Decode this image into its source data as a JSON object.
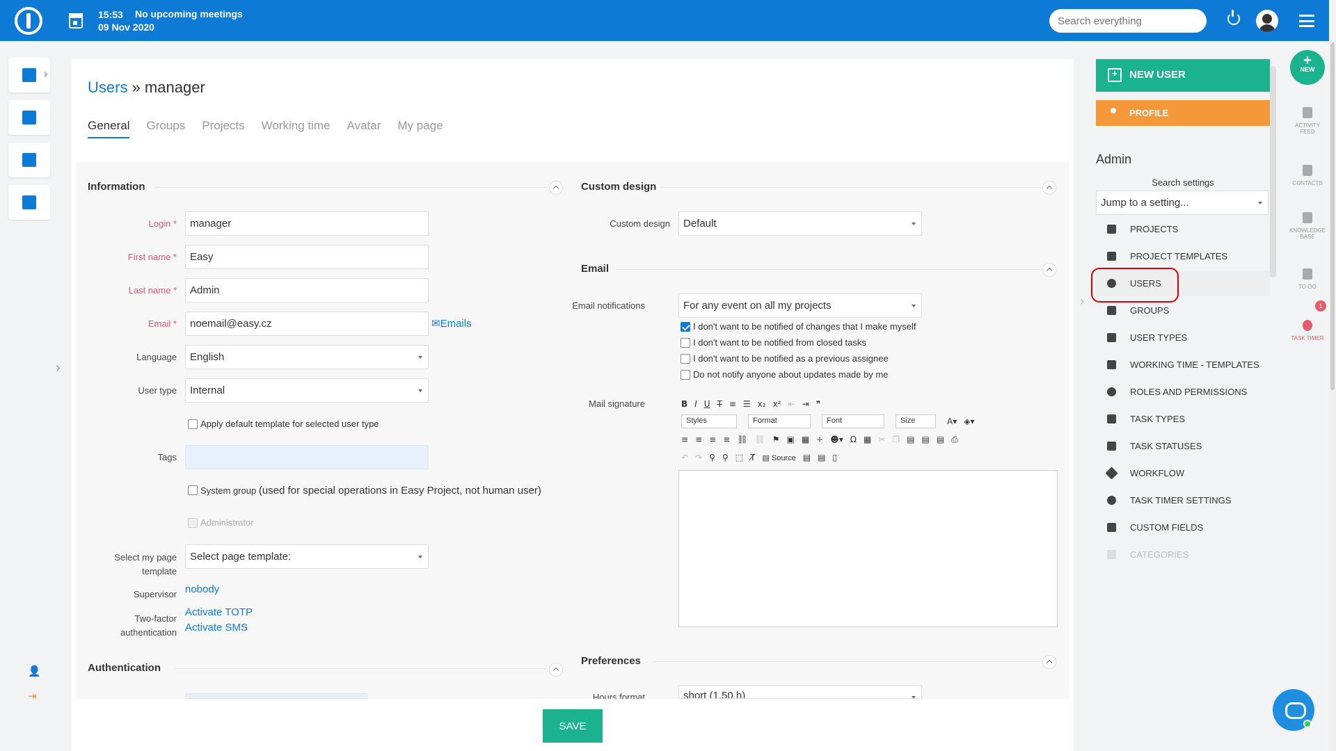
{
  "topbar": {
    "time": "15:53",
    "date": "09 Nov 2020",
    "meetings": "No upcoming meetings",
    "search_placeholder": "Search everything"
  },
  "breadcrumb": {
    "root": "Users",
    "separator": " » ",
    "current": "manager"
  },
  "tabs": [
    "General",
    "Groups",
    "Projects",
    "Working time",
    "Avatar",
    "My page"
  ],
  "information": {
    "title": "Information",
    "login_label": "Login *",
    "login": "manager",
    "first_name_label": "First name *",
    "first_name": "Easy",
    "last_name_label": "Last name *",
    "last_name": "Admin",
    "email_label": "Email *",
    "email": "noemail@easy.cz",
    "emails_link": "Emails",
    "language_label": "Language",
    "language": "English",
    "user_type_label": "User type",
    "user_type": "Internal",
    "apply_template": "Apply default template for selected user type",
    "tags_label": "Tags",
    "system_group": "System group",
    "system_group_note": "(used for special operations in Easy Project, not human user)",
    "administrator": "Administrator",
    "my_page_label_1": "Select my page",
    "my_page_label_2": "template",
    "my_page_value": "Select page template:",
    "supervisor_label": "Supervisor",
    "supervisor": "nobody",
    "twofactor_label_1": "Two-factor",
    "twofactor_label_2": "authentication",
    "activate_totp": "Activate TOTP",
    "activate_sms": "Activate SMS"
  },
  "authentication": {
    "title": "Authentication"
  },
  "custom_design": {
    "title": "Custom design",
    "label": "Custom design",
    "value": "Default"
  },
  "email": {
    "title": "Email",
    "notifications_label": "Email notifications",
    "notifications_value": "For any event on all my projects",
    "opt1": "I don't want to be notified of changes that I make myself",
    "opt2": "I don't want to be notified from closed tasks",
    "opt3": "I don't want to be notified as a previous assignee",
    "opt4": "Do not notify anyone about updates made by me",
    "signature_label": "Mail signature",
    "toolbar_styles": "Styles",
    "toolbar_format": "Format",
    "toolbar_font": "Font",
    "toolbar_size": "Size",
    "toolbar_source": "Source"
  },
  "preferences": {
    "title": "Preferences",
    "hours_label": "Hours format",
    "hours_value": "short (1.50 h)"
  },
  "save_label": "SAVE",
  "sidebar": {
    "new_user": "NEW USER",
    "profile": "PROFILE",
    "admin_title": "Admin",
    "search_settings": "Search settings",
    "jump": "Jump to a setting...",
    "items": [
      "PROJECTS",
      "PROJECT TEMPLATES",
      "USERS",
      "GROUPS",
      "USER TYPES",
      "WORKING TIME - TEMPLATES",
      "ROLES AND PERMISSIONS",
      "TASK TYPES",
      "TASK STATUSES",
      "WORKFLOW",
      "TASK TIMER SETTINGS",
      "CUSTOM FIELDS",
      "CATEGORIES"
    ]
  },
  "rail": {
    "new": "NEW",
    "activity_1": "ACTIVITY",
    "activity_2": "FEED",
    "contacts": "CONTACTS",
    "knowledge_1": "KNOWLEDGE",
    "knowledge_2": "BASE",
    "todo": "TO-DO",
    "todo_badge": "1",
    "timer": "TASK TIMER"
  },
  "colors": {
    "brand": "#0d7ad6",
    "save": "#1bb38f",
    "profile": "#f4983a",
    "required": "#e0566b"
  }
}
